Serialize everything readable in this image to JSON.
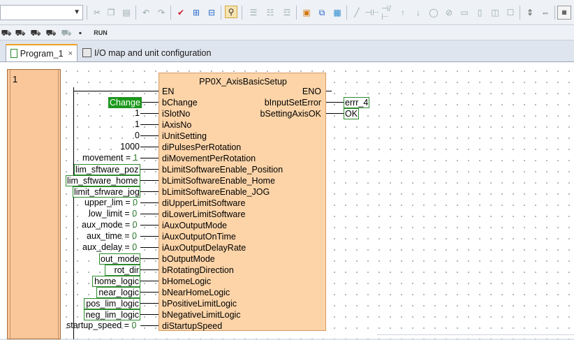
{
  "toolbar": {
    "icons": [
      "cut-icon",
      "copy-icon",
      "paste-icon",
      "undo-icon",
      "redo-icon",
      "check-program-icon",
      "check-all-icon",
      "compile-icon",
      "monitor-toggle-icon",
      "insert-rung-above-icon",
      "insert-rung-below-icon",
      "find-icon",
      "program-properties-icon",
      "cross-reference-icon",
      "contact-icon",
      "contact-nc-icon",
      "coil-icon",
      "coil-nc-icon",
      "function-block-icon",
      "instruction-icon",
      "comment-icon",
      "variable-table-icon"
    ],
    "run_label": "RUN"
  },
  "tabs": [
    {
      "label": "Program_1",
      "active": true,
      "close": "×"
    },
    {
      "label": "I/O map and unit configuration",
      "active": false
    }
  ],
  "rung": {
    "number": "1"
  },
  "function_block": {
    "title": "PP0X_AxisBasicSetup",
    "inputs": [
      "EN",
      "bChange",
      "iSlotNo",
      "iAxisNo",
      "iUnitSetting",
      "diPulsesPerRotation",
      "diMovementPerRotation",
      "bLimitSoftwareEnable_Position",
      "bLimitSoftwareEnable_Home",
      "bLimitSoftwareEnable_JOG",
      "diUpperLimitSoftware",
      "diLowerLimitSoftware",
      "iAuxOutputMode",
      "iAuxOutputOnTime",
      "iAuxOutputDelayRate",
      "bOutputMode",
      "bRotatingDirection",
      "bHomeLogic",
      "bNearHomeLogic",
      "bPositiveLimitLogic",
      "bNegativeLimitLogic",
      "diStartupSpeed"
    ],
    "outputs": [
      "ENO",
      "bInputSetError",
      "bSettingAxisOK"
    ]
  },
  "input_values": {
    "change": "Change",
    "slot_no": "1",
    "axis_no": "1",
    "unit_setting": "0",
    "pulses": "1000",
    "movement_name": "movement",
    "movement_value": "1",
    "lim_pos": "lim_sftware_poz",
    "lim_home": "lim_sftware_home",
    "lim_jog": "limit_sfrware_jog",
    "upper_name": "upper_lim",
    "upper_value": "0",
    "lower_name": "low_limit",
    "lower_value": "0",
    "aux_mode_name": "aux_mode",
    "aux_mode_value": "0",
    "aux_time_name": "aux_time",
    "aux_time_value": "0",
    "aux_delay_name": "aux_delay",
    "aux_delay_value": "0",
    "out_mode": "out_mode",
    "rot_dir": "rot_dir",
    "home_logic": "home_logic",
    "near_logic": "near_logic",
    "pos_lim_logic": "pos_lim_logic",
    "neg_lim_logic": "neg_lim_logic",
    "startup_name": "startup_speed",
    "startup_value": "0",
    "equals": "="
  },
  "output_values": {
    "error": "errr_4",
    "ok": "OK"
  },
  "colors": {
    "fb_fill": "#fcd4a8",
    "gutter_fill": "#f9c79a",
    "var_border": "#2c8a2c",
    "tab_accent": "#f0a020"
  }
}
